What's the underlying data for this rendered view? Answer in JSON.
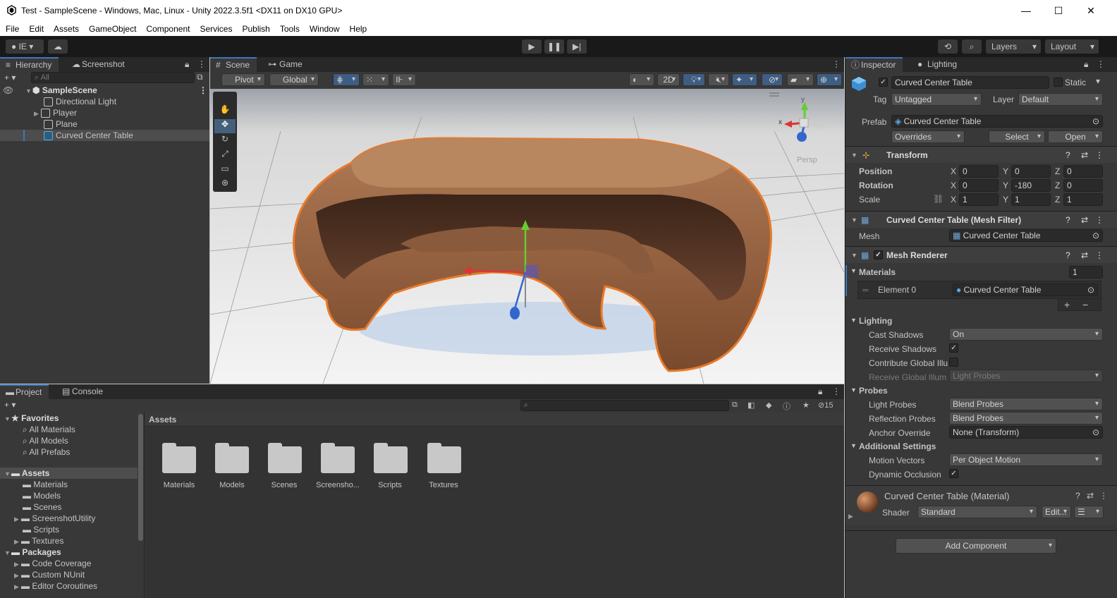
{
  "window": {
    "title": "Test - SampleScene - Windows, Mac, Linux - Unity 2022.3.5f1 <DX11 on DX10 GPU>",
    "controls": [
      "—",
      "☐",
      "✕"
    ]
  },
  "menu": [
    "File",
    "Edit",
    "Assets",
    "GameObject",
    "Component",
    "Services",
    "Publish",
    "Tools",
    "Window",
    "Help"
  ],
  "toolbar": {
    "account": "IE",
    "layers": "Layers",
    "layout": "Layout"
  },
  "hierarchy": {
    "tabs": [
      "Hierarchy",
      "Screenshot"
    ],
    "search_placeholder": "All",
    "scene": "SampleScene",
    "items": [
      "Directional Light",
      "Player",
      "Plane",
      "Curved Center Table"
    ]
  },
  "scene_view": {
    "tabs": [
      "Scene",
      "Game"
    ],
    "pivot": "Pivot",
    "global": "Global",
    "mode_2d": "2D",
    "gizmo_axes": {
      "x": "x",
      "y": "y"
    },
    "persp": "Persp"
  },
  "inspector": {
    "tabs": [
      "Inspector",
      "Lighting"
    ],
    "object_name": "Curved Center Table",
    "static_label": "Static",
    "tag_label": "Tag",
    "tag_value": "Untagged",
    "layer_label": "Layer",
    "layer_value": "Default",
    "prefab_label": "Prefab",
    "prefab_value": "Curved Center Table",
    "overrides": "Overrides",
    "select": "Select",
    "open": "Open",
    "transform": {
      "title": "Transform",
      "position_label": "Position",
      "rotation_label": "Rotation",
      "scale_label": "Scale",
      "position": {
        "x": "0",
        "y": "0",
        "z": "0"
      },
      "rotation": {
        "x": "0",
        "y": "-180",
        "z": "0"
      },
      "scale": {
        "x": "1",
        "y": "1",
        "z": "1"
      }
    },
    "mesh_filter": {
      "title": "Curved Center Table (Mesh Filter)",
      "mesh_label": "Mesh",
      "mesh_value": "Curved Center Table"
    },
    "mesh_renderer": {
      "title": "Mesh Renderer",
      "materials_label": "Materials",
      "materials_count": "1",
      "element_label": "Element 0",
      "element_value": "Curved Center Table",
      "lighting_label": "Lighting",
      "cast_shadows_label": "Cast Shadows",
      "cast_shadows_value": "On",
      "receive_shadows_label": "Receive Shadows",
      "contribute_gi_label": "Contribute Global Illu",
      "receive_gi_label": "Receive Global Illum",
      "receive_gi_value": "Light Probes",
      "probes_label": "Probes",
      "light_probes_label": "Light Probes",
      "light_probes_value": "Blend Probes",
      "reflection_probes_label": "Reflection Probes",
      "reflection_probes_value": "Blend Probes",
      "anchor_override_label": "Anchor Override",
      "anchor_override_value": "None (Transform)",
      "additional_label": "Additional Settings",
      "motion_vectors_label": "Motion Vectors",
      "motion_vectors_value": "Per Object Motion",
      "dynamic_occlusion_label": "Dynamic Occlusion"
    },
    "material": {
      "title": "Curved Center Table (Material)",
      "shader_label": "Shader",
      "shader_value": "Standard",
      "edit": "Edit..."
    },
    "add_component": "Add Component"
  },
  "project": {
    "tabs": [
      "Project",
      "Console"
    ],
    "hidden_count": "15",
    "favorites_label": "Favorites",
    "favorites": [
      "All Materials",
      "All Models",
      "All Prefabs"
    ],
    "assets_label": "Assets",
    "asset_folders": [
      "Materials",
      "Models",
      "Scenes",
      "ScreenshotUtility",
      "Scripts",
      "Textures"
    ],
    "packages_label": "Packages",
    "packages": [
      "Code Coverage",
      "Custom NUnit",
      "Editor Coroutines"
    ],
    "breadcrumb": "Assets",
    "grid_items": [
      "Materials",
      "Models",
      "Scenes",
      "Screensho...",
      "Scripts",
      "Textures"
    ]
  }
}
